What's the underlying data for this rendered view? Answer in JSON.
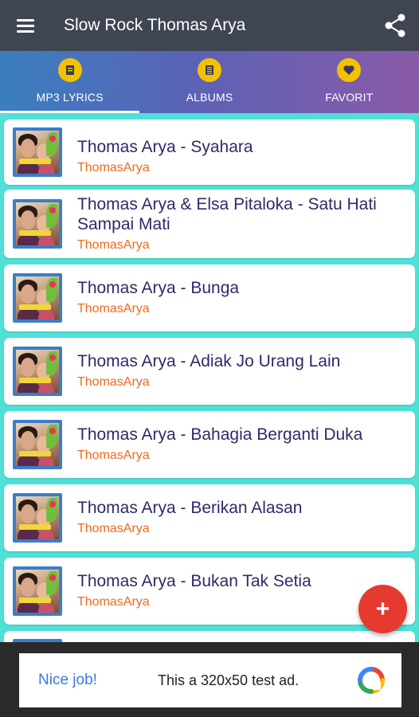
{
  "appbar": {
    "title": "Slow Rock Thomas Arya",
    "menu_icon": "hamburger-menu-icon",
    "share_icon": "share-icon"
  },
  "tabs": [
    {
      "label": "MP3 LYRICS",
      "icon": "music-file-icon",
      "active": true
    },
    {
      "label": "ALBUMS",
      "icon": "album-icon",
      "active": false
    },
    {
      "label": "FAVORIT",
      "icon": "heart-icon",
      "active": false
    }
  ],
  "songs": [
    {
      "title": "Thomas Arya - Syahara",
      "artist": "ThomasArya"
    },
    {
      "title": "Thomas Arya & Elsa Pitaloka - Satu Hati Sampai Mati",
      "artist": "ThomasArya"
    },
    {
      "title": "Thomas Arya - Bunga",
      "artist": "ThomasArya"
    },
    {
      "title": "Thomas Arya - Adiak Jo Urang Lain",
      "artist": "ThomasArya"
    },
    {
      "title": "Thomas Arya - Bahagia Berganti Duka",
      "artist": "ThomasArya"
    },
    {
      "title": "Thomas Arya - Berikan Alasan",
      "artist": "ThomasArya"
    },
    {
      "title": "Thomas Arya - Bukan Tak Setia",
      "artist": "ThomasArya"
    }
  ],
  "fab": {
    "label": "+",
    "icon": "add-icon"
  },
  "ad": {
    "nice_job": "Nice job!",
    "text": "This a 320x50 test ad.",
    "logo_icon": "ad-logo-icon"
  },
  "colors": {
    "appbar": "#3f4652",
    "tab_icon": "#f2c200",
    "list_background": "#4fe0d8",
    "song_title": "#2b2b6b",
    "artist": "#f26a1b",
    "fab": "#e53a2f",
    "ad_link": "#3b78e7"
  }
}
